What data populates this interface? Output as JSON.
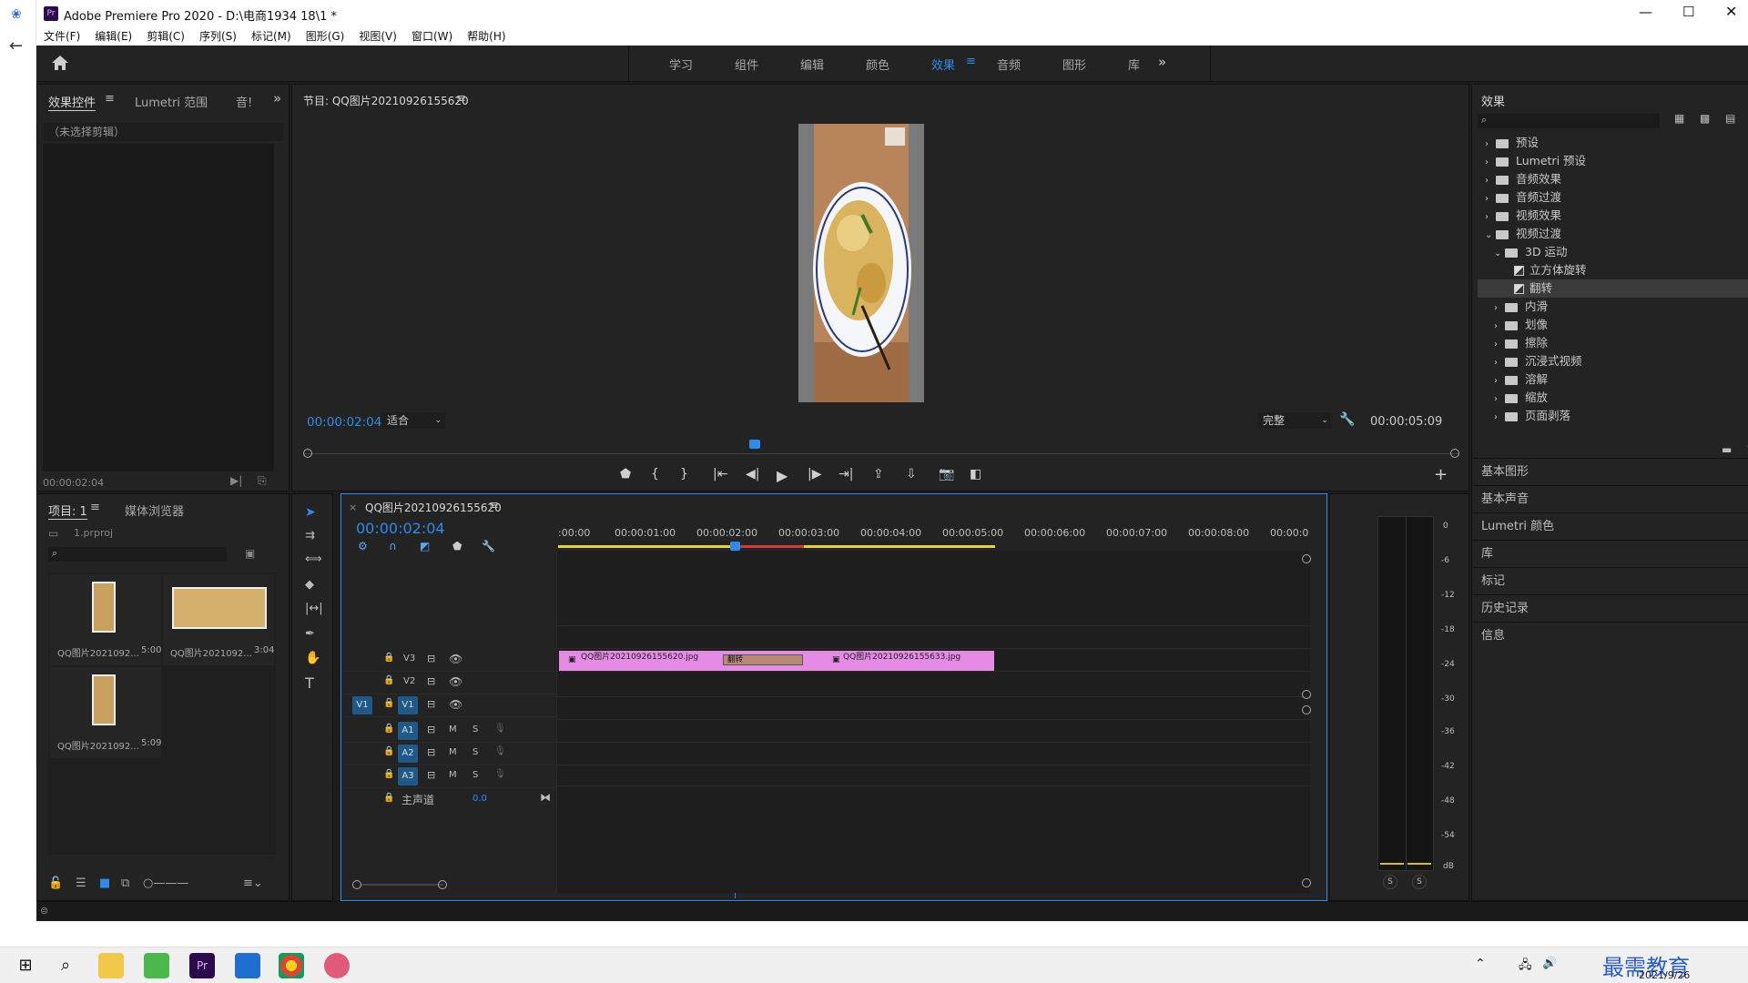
{
  "window": {
    "title": "Adobe Premiere Pro 2020 - D:\\电商1934 18\\1 *",
    "app_icon": "Pr"
  },
  "menu": [
    "文件(F)",
    "编辑(E)",
    "剪辑(C)",
    "序列(S)",
    "标记(M)",
    "图形(G)",
    "视图(V)",
    "窗口(W)",
    "帮助(H)"
  ],
  "workspaces": [
    "学习",
    "组件",
    "编辑",
    "颜色",
    "效果",
    "音频",
    "图形",
    "库"
  ],
  "active_workspace": "效果",
  "effect_controls": {
    "tabs": [
      "效果控件",
      "Lumetri 范围",
      "音!"
    ],
    "no_clip": "（未选择剪辑）",
    "timecode": "00:00:02:04"
  },
  "program": {
    "title": "节目: QQ图片20210926155620",
    "timecode": "00:00:02:04",
    "fit": "适合",
    "quality": "完整",
    "duration": "00:00:05:09"
  },
  "project": {
    "tabs": [
      "项目: 1",
      "媒体浏览器"
    ],
    "file": "1.prproj",
    "items": [
      {
        "name": "QQ图片2021092...",
        "dur": "5:00"
      },
      {
        "name": "QQ图片2021092...",
        "dur": "3:04"
      },
      {
        "name": "QQ图片2021092...",
        "dur": "5:09"
      }
    ]
  },
  "timeline": {
    "title": "QQ图片20210926155620",
    "timecode": "00:00:02:04",
    "ruler": [
      ":00:00",
      "00:00:01:00",
      "00:00:02:00",
      "00:00:03:00",
      "00:00:04:00",
      "00:00:05:00",
      "00:00:06:00",
      "00:00:07:00",
      "00:00:08:00",
      "00:00:0"
    ],
    "video_tracks": [
      "V3",
      "V2",
      "V1"
    ],
    "audio_tracks": [
      "A1",
      "A2",
      "A3"
    ],
    "master": "主声道",
    "master_val": "0.0",
    "clip1": "QQ图片20210926155620.jpg",
    "clip2": "QQ图片20210926155633.jpg",
    "transition": "翻转"
  },
  "meter": {
    "labels": [
      "0",
      "-6",
      "-12",
      "-18",
      "-24",
      "-30",
      "-36",
      "-42",
      "-48",
      "-54",
      "dB"
    ],
    "solo": [
      "S",
      "S"
    ]
  },
  "effects": {
    "title": "效果",
    "tree": [
      {
        "label": "预设",
        "depth": 0,
        "type": "folder"
      },
      {
        "label": "Lumetri 预设",
        "depth": 0,
        "type": "folder"
      },
      {
        "label": "音频效果",
        "depth": 0,
        "type": "folder"
      },
      {
        "label": "音频过渡",
        "depth": 0,
        "type": "folder"
      },
      {
        "label": "视频效果",
        "depth": 0,
        "type": "folder"
      },
      {
        "label": "视频过渡",
        "depth": 0,
        "type": "folder",
        "open": true
      },
      {
        "label": "3D 运动",
        "depth": 1,
        "type": "folder",
        "open": true
      },
      {
        "label": "立方体旋转",
        "depth": 2,
        "type": "fx"
      },
      {
        "label": "翻转",
        "depth": 2,
        "type": "fx",
        "selected": true
      },
      {
        "label": "内滑",
        "depth": 1,
        "type": "folder"
      },
      {
        "label": "划像",
        "depth": 1,
        "type": "folder"
      },
      {
        "label": "擦除",
        "depth": 1,
        "type": "folder"
      },
      {
        "label": "沉浸式视频",
        "depth": 1,
        "type": "folder"
      },
      {
        "label": "溶解",
        "depth": 1,
        "type": "folder"
      },
      {
        "label": "缩放",
        "depth": 1,
        "type": "folder"
      },
      {
        "label": "页面剥落",
        "depth": 1,
        "type": "folder"
      }
    ],
    "sections": [
      "基本图形",
      "基本声音",
      "Lumetri 颜色",
      "库",
      "标记",
      "历史记录",
      "信息"
    ]
  },
  "taskbar": {
    "date": "2021/9/26",
    "watermark": "最需教育"
  },
  "colors": {
    "accent": "#2d8ceb",
    "clip": "#e58be6",
    "bg": "#232323"
  }
}
